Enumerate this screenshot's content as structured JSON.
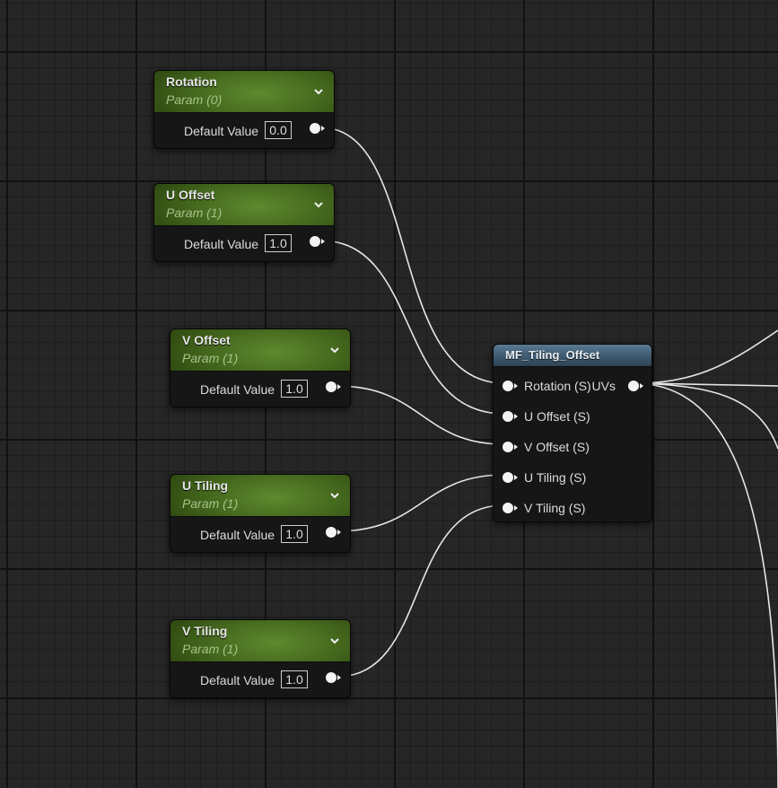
{
  "param_nodes": [
    {
      "title": "Rotation",
      "subtitle": "Param (0)",
      "row_label": "Default Value",
      "value": "0.0"
    },
    {
      "title": "U Offset",
      "subtitle": "Param (1)",
      "row_label": "Default Value",
      "value": "1.0"
    },
    {
      "title": "V Offset",
      "subtitle": "Param (1)",
      "row_label": "Default Value",
      "value": "1.0"
    },
    {
      "title": "U Tiling",
      "subtitle": "Param (1)",
      "row_label": "Default Value",
      "value": "1.0"
    },
    {
      "title": "V Tiling",
      "subtitle": "Param (1)",
      "row_label": "Default Value",
      "value": "1.0"
    }
  ],
  "function_node": {
    "title": "MF_Tiling_Offset",
    "inputs": [
      "Rotation (S)",
      "U Offset (S)",
      "V Offset (S)",
      "U Tiling (S)",
      "V Tiling (S)"
    ],
    "output": "UVs"
  },
  "icons": {
    "collapse": "chevron-down-icon",
    "pin": "pin-icon"
  },
  "colors": {
    "param_header": "#4f7a24",
    "function_header": "#4a6a82",
    "wire": "#e8e8e8",
    "background": "#262626"
  }
}
